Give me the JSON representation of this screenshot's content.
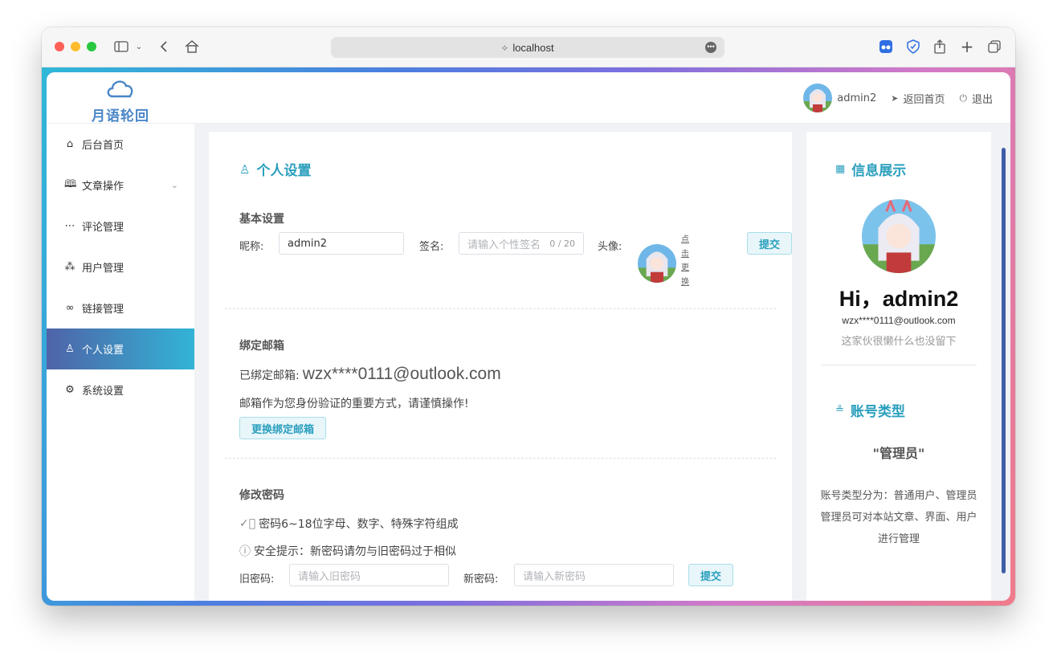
{
  "browser": {
    "url": "localhost"
  },
  "header": {
    "logo_text": "月语轮回",
    "username": "admin2",
    "home_link": "返回首页",
    "logout": "退出"
  },
  "sidebar": {
    "items": [
      {
        "label": "后台首页",
        "icon": "home-icon"
      },
      {
        "label": "文章操作",
        "icon": "book-icon"
      },
      {
        "label": "评论管理",
        "icon": "comment-icon"
      },
      {
        "label": "用户管理",
        "icon": "users-icon"
      },
      {
        "label": "链接管理",
        "icon": "link-icon"
      },
      {
        "label": "个人设置",
        "icon": "user-icon"
      },
      {
        "label": "系统设置",
        "icon": "settings-icon"
      }
    ],
    "active_index": 5
  },
  "profile": {
    "title": "个人设置",
    "basic": {
      "heading": "基本设置",
      "nickname_label": "昵称:",
      "nickname_value": "admin2",
      "signature_label": "签名:",
      "signature_placeholder": "请输入个性签名",
      "signature_count": "0 / 20",
      "avatar_label": "头像:",
      "change_hint": [
        "点",
        "击",
        "更",
        "换"
      ],
      "submit": "提交"
    },
    "email": {
      "heading": "绑定邮箱",
      "bound_label": "已绑定邮箱:",
      "bound_value": "wzx****0111@outlook.com",
      "note": "邮箱作为您身份验证的重要方式，请谨慎操作!",
      "change_button": "更换绑定邮箱"
    },
    "password": {
      "heading": "修改密码",
      "rule": "密码6~18位字母、数字、特殊字符组成",
      "tip": "安全提示：新密码请勿与旧密码过于相似",
      "old_label": "旧密码:",
      "old_placeholder": "请输入旧密码",
      "new_label": "新密码:",
      "new_placeholder": "请输入新密码",
      "submit": "提交"
    }
  },
  "info": {
    "title": "信息展示",
    "greeting": "Hi，admin2",
    "email": "wzx****0111@outlook.com",
    "bio": "这家伙很懒什么也没留下",
    "account_type_title": "账号类型",
    "account_type": "\"管理员\"",
    "desc1": "账号类型分为：普通用户、管理员",
    "desc2": "管理员可对本站文章、界面、用户进行管理"
  },
  "colors": {
    "accent": "#2a9fbd",
    "active_start": "#4f63a8",
    "active_end": "#32b4d6"
  }
}
